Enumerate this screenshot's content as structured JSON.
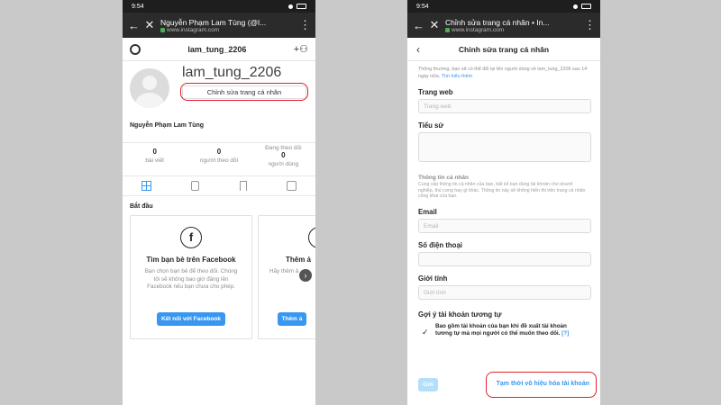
{
  "status_bar": {
    "time": "9:54"
  },
  "left": {
    "browser": {
      "title": "Nguyễn Phạm Lam Tùng (@l...",
      "url": "www.instagram.com"
    },
    "header": {
      "username": "lam_tung_2206"
    },
    "profile": {
      "username_big": "lam_tung_2206",
      "edit_button": "Chỉnh sửa trang cá nhân",
      "full_name": "Nguyễn Phạm Lam Tùng"
    },
    "stats": [
      {
        "value": "0",
        "label": "bài viết"
      },
      {
        "value": "0",
        "label": "người theo dõi"
      },
      {
        "value": "0",
        "label_top": "Đang theo dõi",
        "label": "người dùng"
      }
    ],
    "section_title": "Bắt đầu",
    "cards": [
      {
        "icon_text": "f",
        "title": "Tìm bạn bè trên Facebook",
        "desc": "Bạn chọn bạn bè để theo dõi. Chúng tôi sẽ không bao giờ đăng lên Facebook nếu bạn chưa cho phép.",
        "button": "Kết nối với Facebook"
      },
      {
        "title": "Thêm ả",
        "desc": "Hãy thêm ả",
        "button": "Thêm ả"
      }
    ]
  },
  "right": {
    "browser": {
      "title": "Chỉnh sửa trang cá nhân • In...",
      "url": "www.instagram.com"
    },
    "header": {
      "title": "Chỉnh sửa trang cá nhân"
    },
    "note": "Thông thường, bạn sẽ có thể đổi lại tên người dùng về lam_tung_2206 sau 14 ngày nữa.",
    "note_link": "Tìm hiểu thêm",
    "fields": {
      "website": {
        "label": "Trang web",
        "placeholder": "Trang web"
      },
      "bio": {
        "label": "Tiểu sử"
      },
      "email": {
        "label": "Email",
        "placeholder": "Email"
      },
      "phone": {
        "label": "Số điện thoại"
      },
      "gender": {
        "label": "Giới tính",
        "placeholder": "Giới tính"
      }
    },
    "personal_info": {
      "title": "Thông tin cá nhân",
      "desc": "Cung cấp thông tin cá nhân của bạn, bất kể bạn dùng tài khoản cho doanh nghiệp, thú cưng hay gì khác. Thông tin này sẽ không hiển thị trên trang cá nhân công khai của bạn."
    },
    "suggest": {
      "label": "Gợi ý tài khoản tương tự",
      "text": "Bao gồm tài khoản của bạn khi đề xuất tài khoản tương tự mà mọi người có thể muốn theo dõi.",
      "help": "[?]"
    },
    "submit_button": "Gửi",
    "deactivate_link": "Tạm thời vô hiệu hóa tài khoản"
  },
  "colors": {
    "accent": "#3897f0",
    "highlight": "#e0202e"
  }
}
